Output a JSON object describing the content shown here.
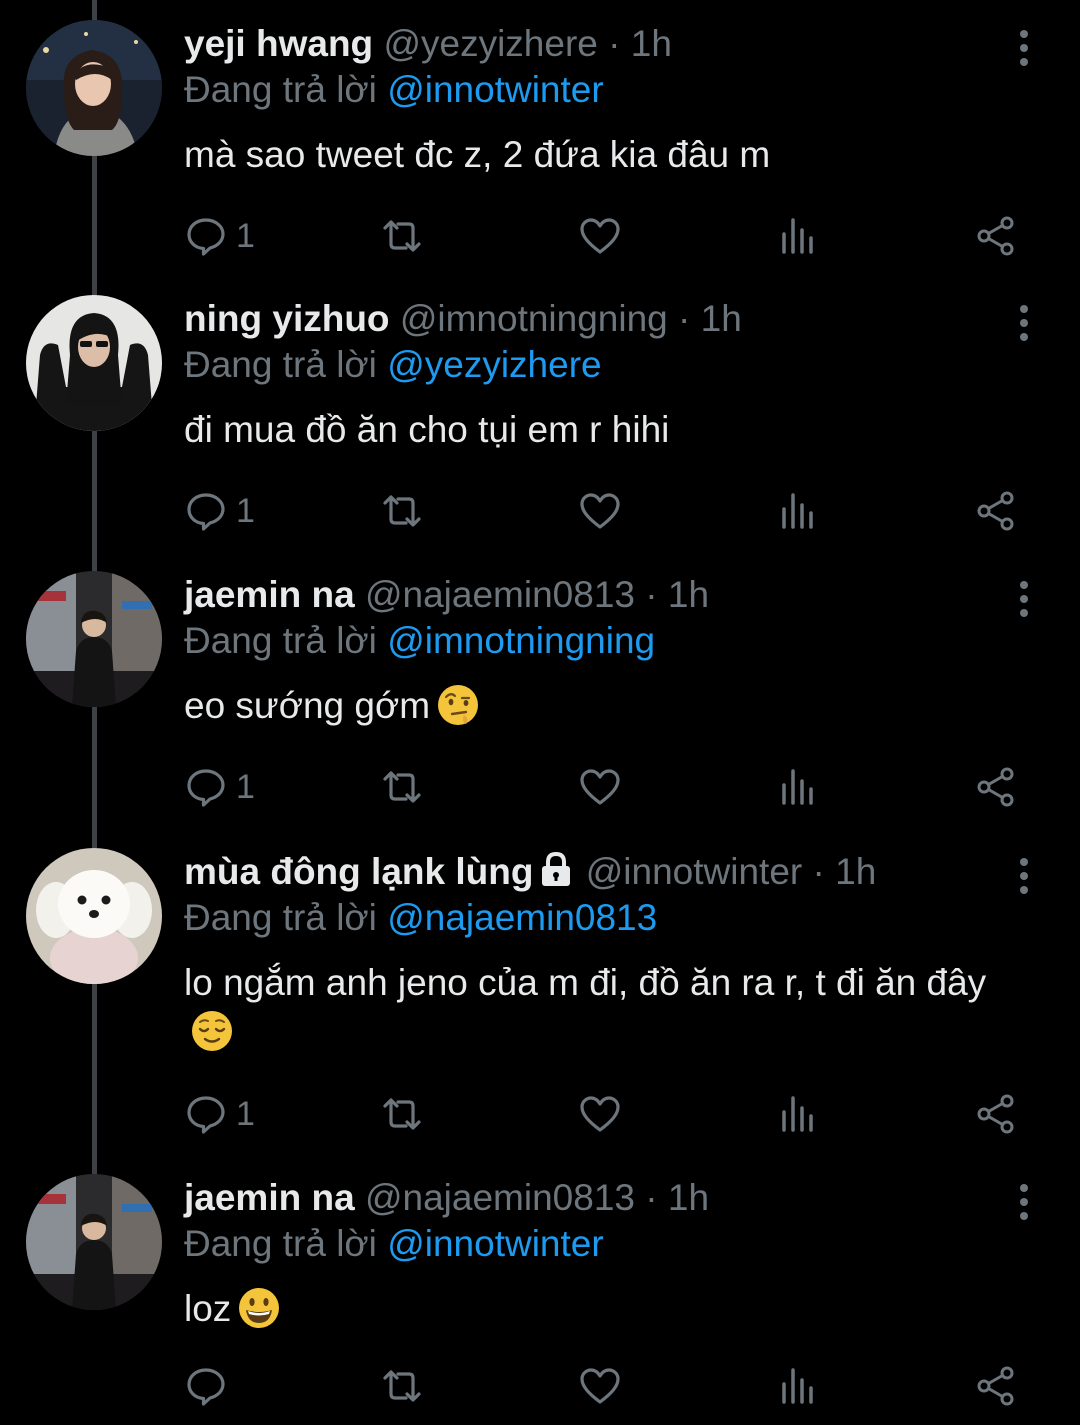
{
  "colors": {
    "background": "#000000",
    "text": "#e7e9ea",
    "muted": "#6e767d",
    "accent": "#1d9bf0",
    "thread_line": "#3d4145"
  },
  "tweets": [
    {
      "name": "yeji hwang",
      "handle": "@yezyizhere",
      "dot": "·",
      "time": "1h",
      "reply_prefix": "Đang trả lời",
      "reply_to": "@innotwinter",
      "text": "mà sao tweet đc z, 2 đứa kia đâu m",
      "reply_count": "1",
      "avatar": "profile-photo-girl-dark-background",
      "emoji": null,
      "locked": false
    },
    {
      "name": "ning yizhuo",
      "handle": "@imnotningning",
      "dot": "·",
      "time": "1h",
      "reply_prefix": "Đang trả lời",
      "reply_to": "@yezyizhere",
      "text": "đi mua đồ ăn cho tụi em r hihi",
      "reply_count": "1",
      "avatar": "profile-photo-girl-sunglasses",
      "emoji": null,
      "locked": false
    },
    {
      "name": "jaemin na",
      "handle": "@najaemin0813",
      "dot": "·",
      "time": "1h",
      "reply_prefix": "Đang trả lời",
      "reply_to": "@imnotningning",
      "text": "eo sướng gớm",
      "reply_count": "1",
      "avatar": "profile-photo-man-street",
      "emoji": "face-with-raised-eyebrow-emoji",
      "locked": false
    },
    {
      "name": "mùa đông lạnk lùng",
      "handle": "@innotwinter",
      "dot": "·",
      "time": "1h",
      "reply_prefix": "Đang trả lời",
      "reply_to": "@najaemin0813",
      "text": "lo ngắm anh jeno của m đi, đồ ăn ra r, t đi ăn đây",
      "reply_count": "1",
      "avatar": "profile-photo-white-puppy",
      "emoji": "relieved-face-emoji",
      "locked": true
    },
    {
      "name": "jaemin na",
      "handle": "@najaemin0813",
      "dot": "·",
      "time": "1h",
      "reply_prefix": "Đang trả lời",
      "reply_to": "@innotwinter",
      "text": "loz",
      "reply_count": "",
      "avatar": "profile-photo-man-street",
      "emoji": "grinning-face-emoji",
      "locked": false
    }
  ]
}
